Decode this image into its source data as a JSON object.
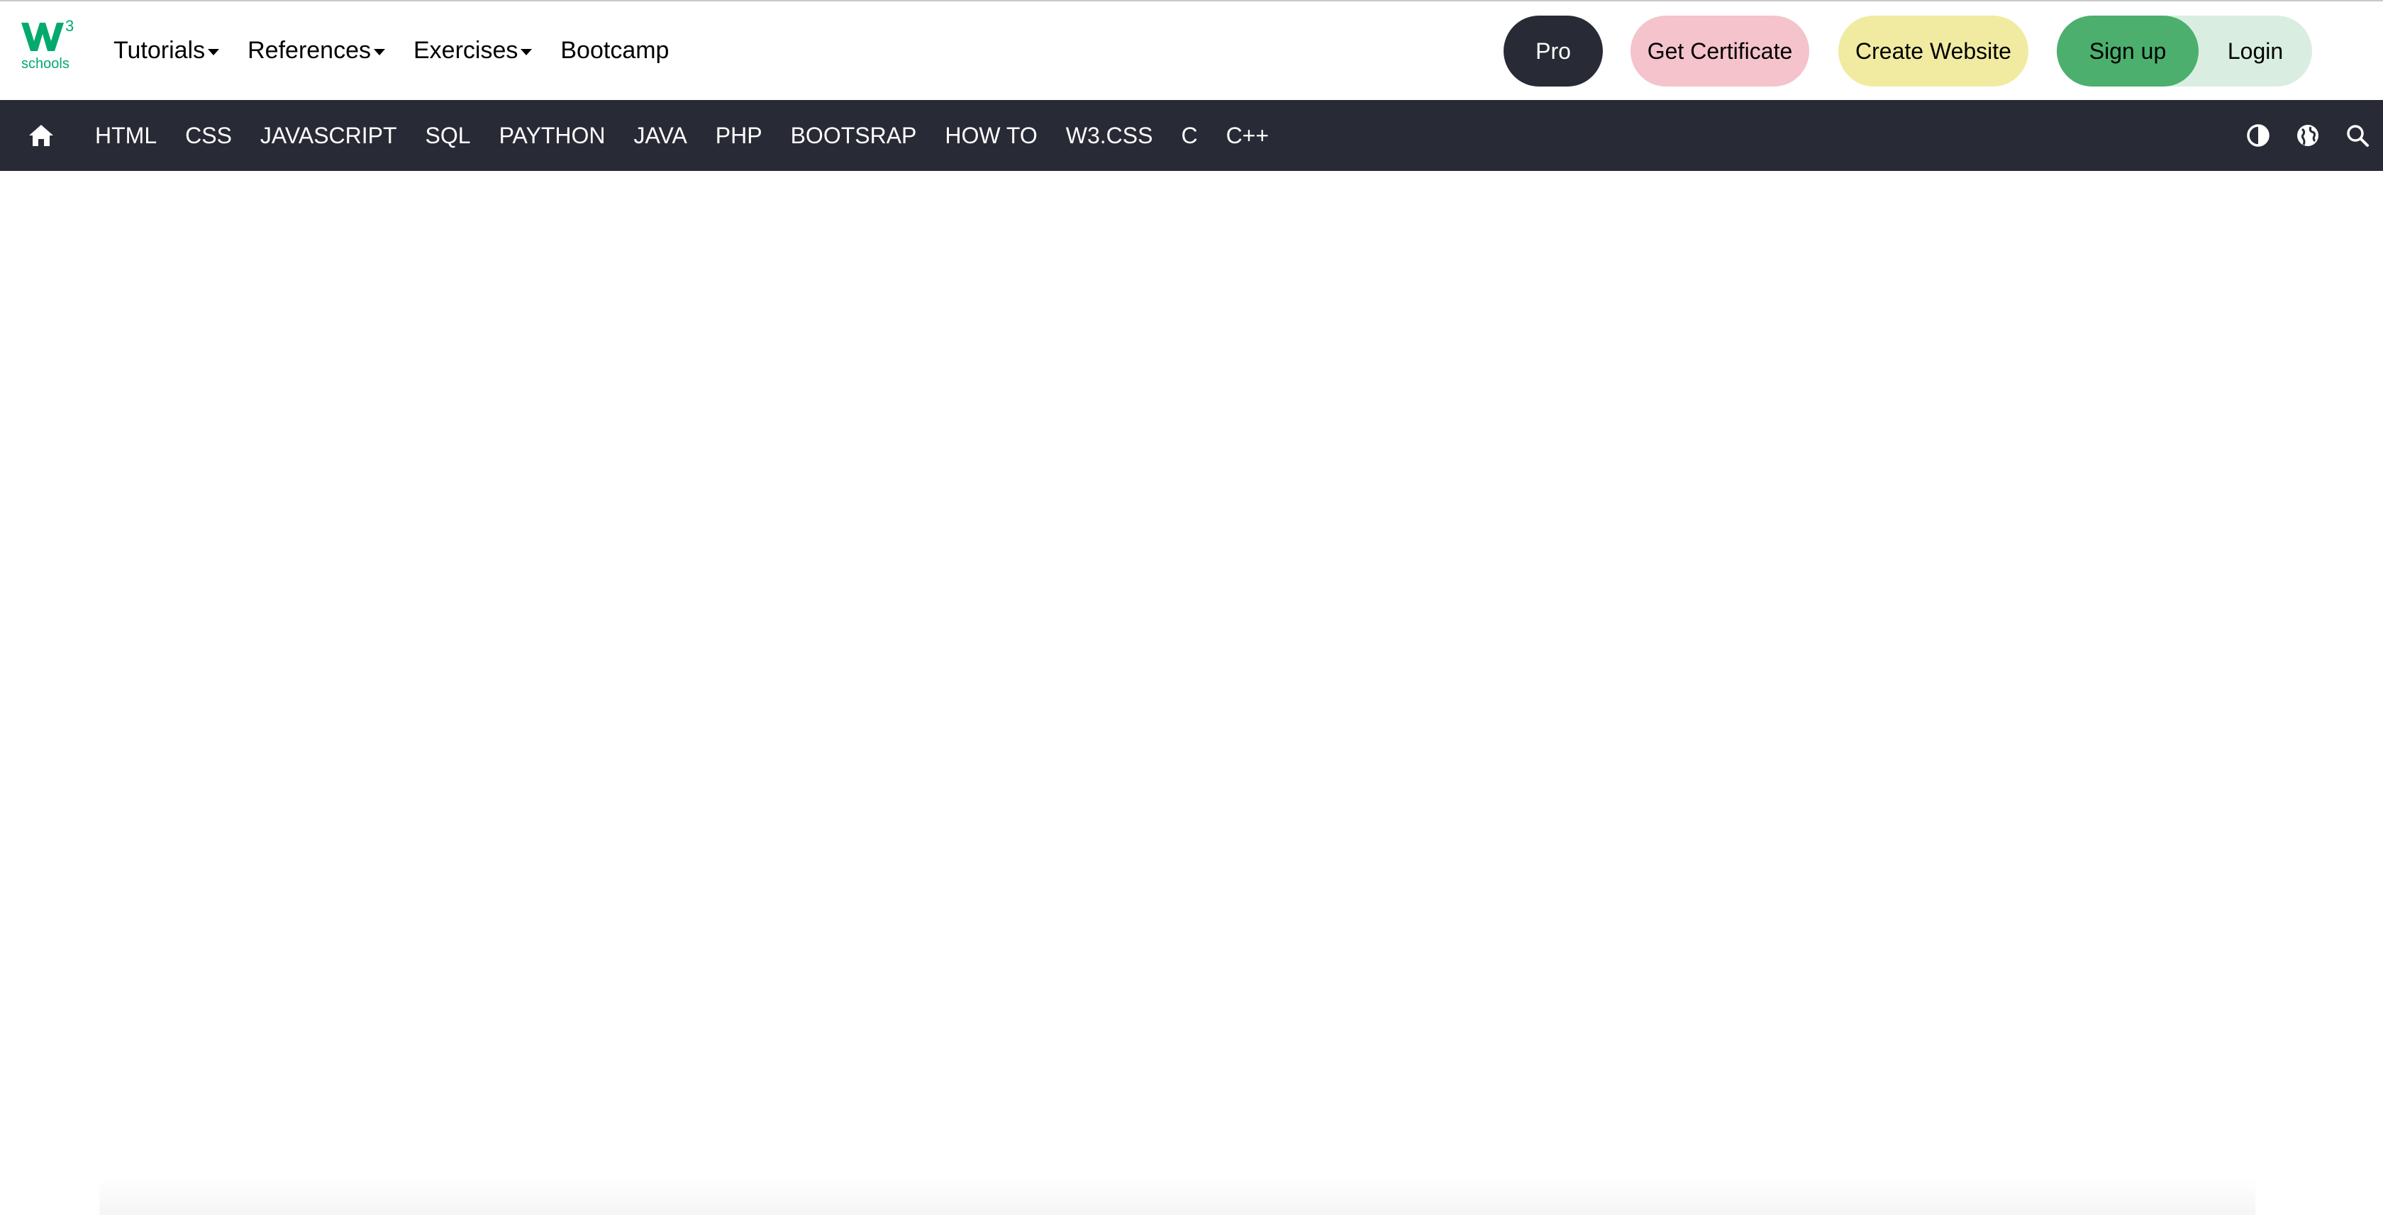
{
  "brand": {
    "logo_text": "schools",
    "logo_sup": "3",
    "colors": {
      "green": "#04aa6d",
      "dark": "#282a35",
      "cert_pink": "#f4c3cc",
      "web_yellow": "#f1eba1",
      "signup_green": "#4caf6e",
      "login_bg": "#d9eee1"
    }
  },
  "topnav": {
    "items": [
      {
        "label": "Tutorials",
        "dropdown": true
      },
      {
        "label": "References",
        "dropdown": true
      },
      {
        "label": "Exercises",
        "dropdown": true
      },
      {
        "label": "Bootcamp",
        "dropdown": false
      }
    ]
  },
  "actions": {
    "pro": "Pro",
    "certificate": "Get Certificate",
    "create_website": "Create Website",
    "signup": "Sign up",
    "login": "Login"
  },
  "navbar": {
    "home_icon": "home-icon",
    "links": [
      "HTML",
      "CSS",
      "JAVASCRIPT",
      "SQL",
      "PAYTHON",
      "JAVA",
      "PHP",
      "BOOTSRAP",
      "HOW TO",
      "W3.CSS",
      "C",
      "C++"
    ],
    "icons": [
      "theme-toggle-icon",
      "globe-icon",
      "search-icon"
    ]
  }
}
